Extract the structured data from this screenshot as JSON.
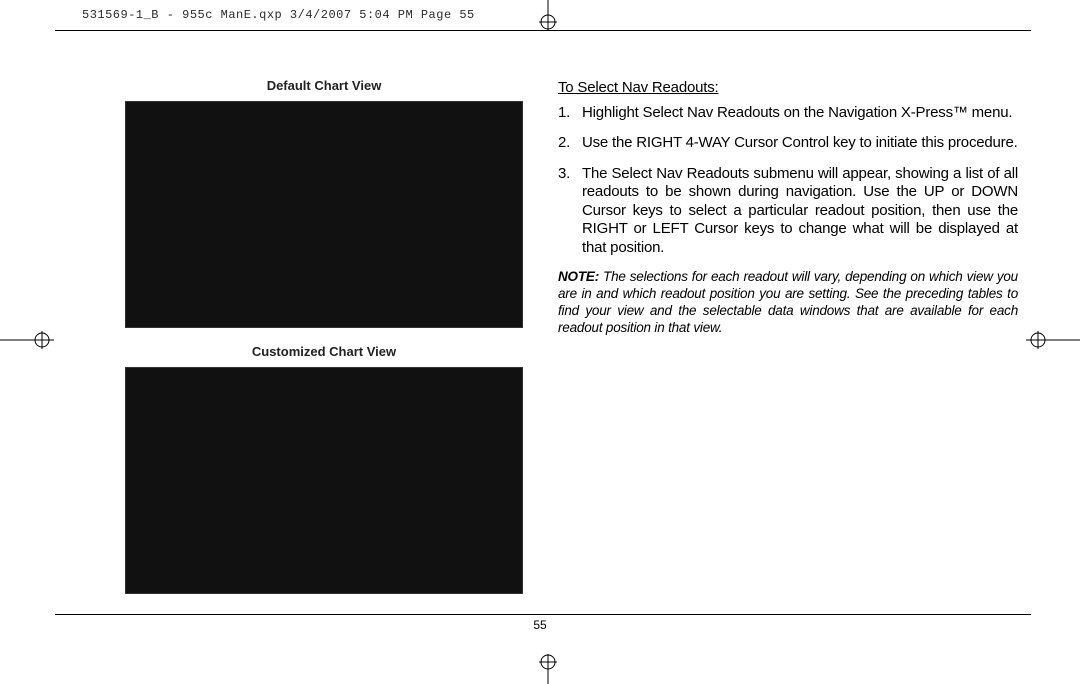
{
  "header": {
    "slug": "531569-1_B - 955c ManE.qxp  3/4/2007  5:04 PM  Page 55"
  },
  "left": {
    "caption1": "Default Chart View",
    "caption2": "Customized Chart View"
  },
  "right": {
    "title": "To Select Nav Readouts:",
    "steps": [
      "Highlight Select Nav Readouts on the Navigation X-Press™ menu.",
      "Use the RIGHT 4-WAY Cursor Control key to initiate this procedure.",
      "The Select Nav Readouts submenu will appear, showing a list of all readouts to be shown during navigation. Use the UP or DOWN Cursor keys to select a particular readout position, then use the RIGHT or LEFT Cursor keys to change what will be displayed at that position."
    ],
    "note_label": "NOTE:",
    "note_body": "The selections for each readout will vary, depending on which view you are in and which readout position you are setting. See the preceding tables to find your view and the selectable data windows that are available for each readout position in that view."
  },
  "page_number": "55"
}
